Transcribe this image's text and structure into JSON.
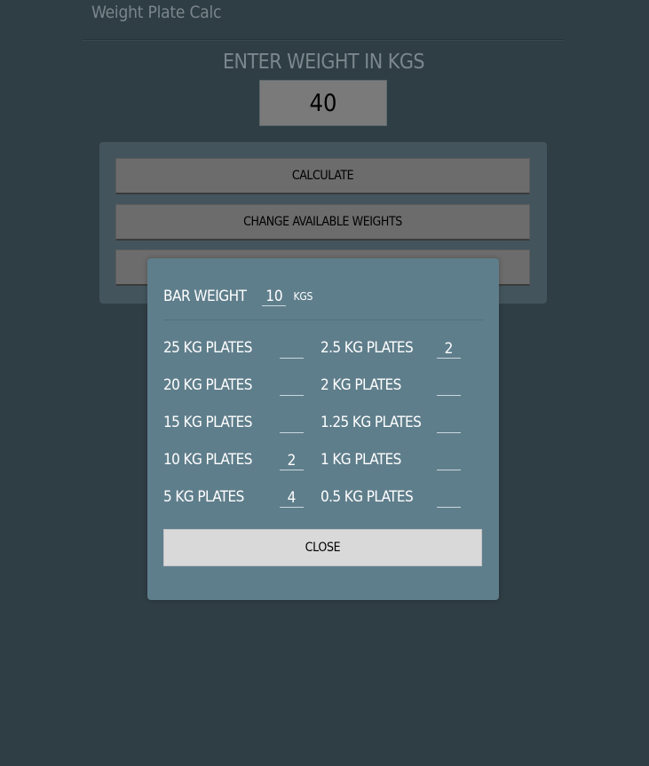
{
  "app": {
    "title": "Weight Plate Calc"
  },
  "main": {
    "prompt": "ENTER WEIGHT IN KGS",
    "weight_value": "40",
    "buttons": {
      "calculate": "CALCULATE",
      "change_weights": "CHANGE AVAILABLE WEIGHTS",
      "third": ""
    }
  },
  "modal": {
    "bar_weight_label": "BAR WEIGHT",
    "bar_weight_value": "10",
    "bar_weight_unit": "KGS",
    "plates_left": [
      {
        "label": "25 KG PLATES",
        "value": ""
      },
      {
        "label": "20 KG PLATES",
        "value": ""
      },
      {
        "label": "15 KG PLATES",
        "value": ""
      },
      {
        "label": "10 KG PLATES",
        "value": "2"
      },
      {
        "label": "5 KG PLATES",
        "value": "4"
      }
    ],
    "plates_right": [
      {
        "label": "2.5 KG PLATES",
        "value": "2"
      },
      {
        "label": "2 KG PLATES",
        "value": ""
      },
      {
        "label": "1.25 KG PLATES",
        "value": ""
      },
      {
        "label": "1 KG PLATES",
        "value": ""
      },
      {
        "label": "0.5 KG PLATES",
        "value": ""
      }
    ],
    "close_label": "CLOSE"
  },
  "colors": {
    "background": "#2f3e45",
    "panel": "#43545c",
    "modal": "#5f7e8b",
    "button": "#6c6c6c",
    "close_button": "#d9d9d9"
  }
}
